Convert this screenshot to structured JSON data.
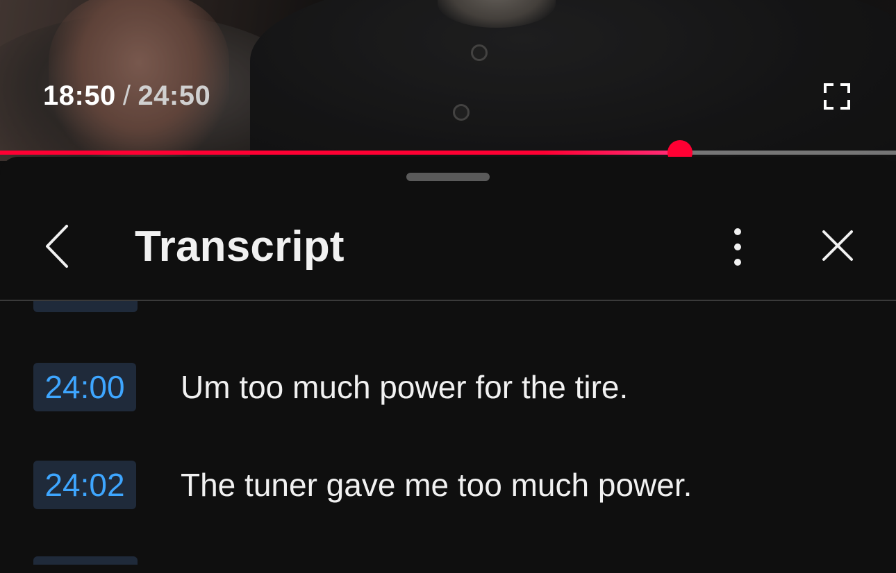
{
  "player": {
    "current_time": "18:50",
    "separator": "/",
    "total_time": "24:50",
    "progress_fraction": 0.759,
    "progress_color": "#ff0033",
    "fullscreen_icon": "fullscreen-icon"
  },
  "transcript": {
    "title": "Transcript",
    "back_icon": "chevron-left-icon",
    "more_icon": "more-vertical-icon",
    "close_icon": "close-icon",
    "segments": [
      {
        "timestamp": "24:00",
        "text": "Um too much power for the tire."
      },
      {
        "timestamp": "24:02",
        "text": "The tuner gave me too much power."
      }
    ],
    "timestamp_color": "#3ea6ff"
  }
}
